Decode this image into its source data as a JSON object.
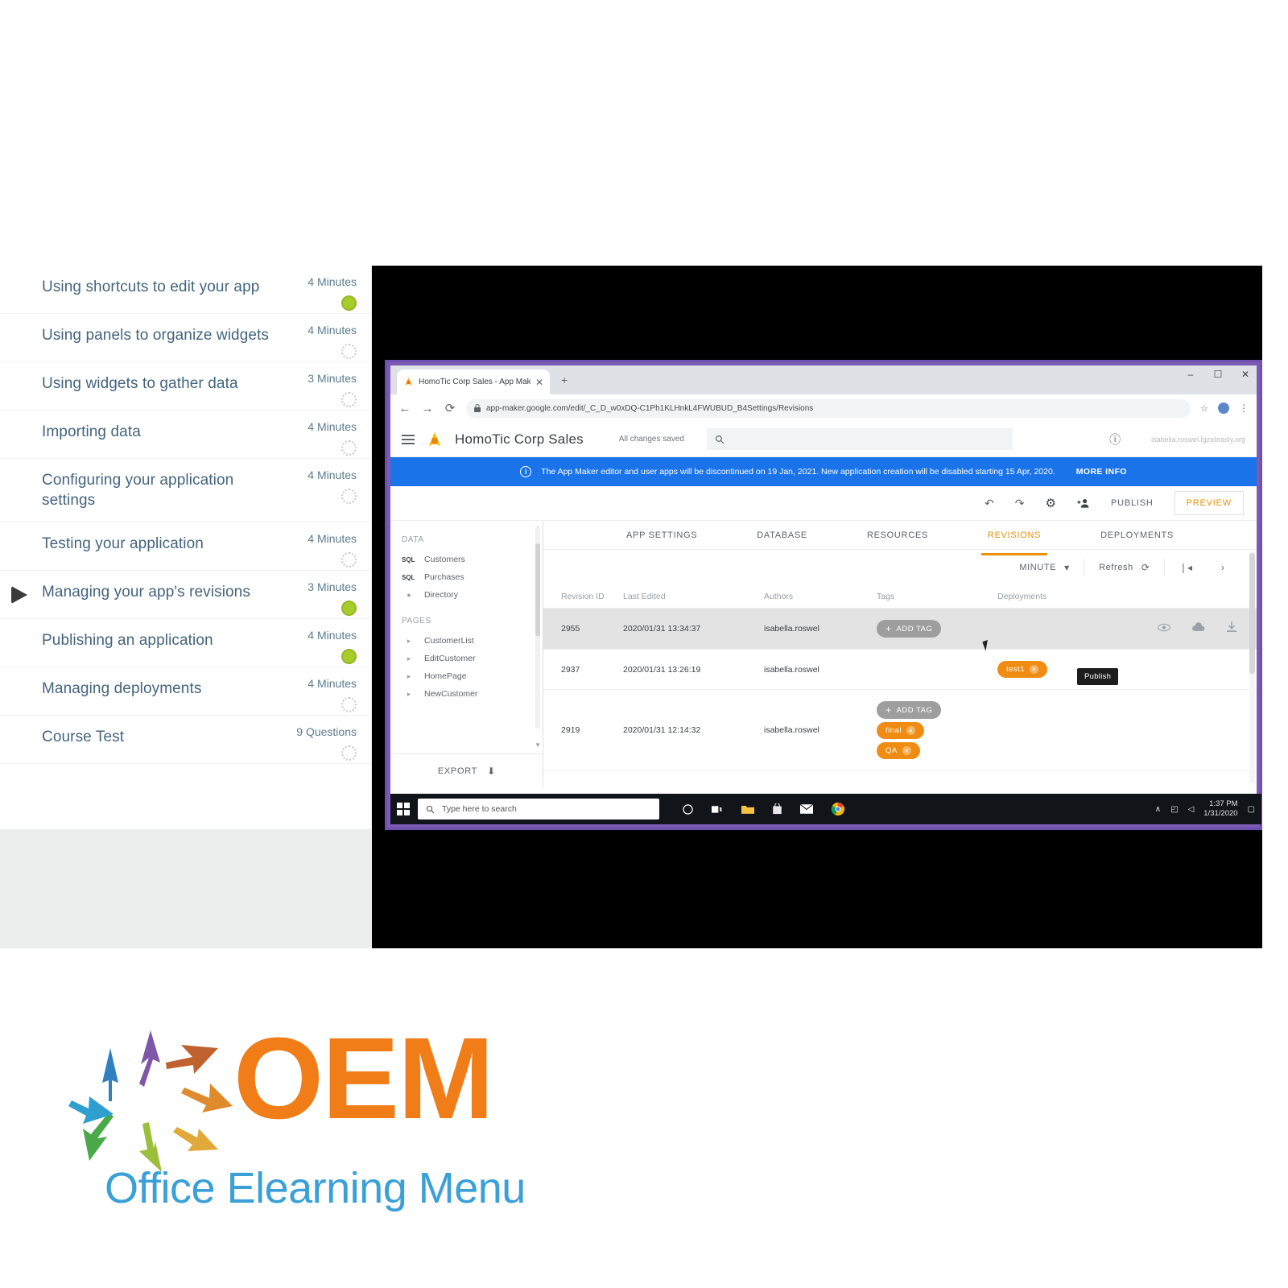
{
  "course": {
    "lessons": [
      {
        "title": "Using shortcuts to edit your app",
        "duration": "4 Minutes",
        "status": "done",
        "current": false
      },
      {
        "title": "Using panels to organize widgets",
        "duration": "4 Minutes",
        "status": "todo",
        "current": false
      },
      {
        "title": "Using widgets to gather data",
        "duration": "3 Minutes",
        "status": "todo",
        "current": false
      },
      {
        "title": "Importing data",
        "duration": "4 Minutes",
        "status": "todo",
        "current": false
      },
      {
        "title": "Configuring your application settings",
        "duration": "4 Minutes",
        "status": "todo",
        "current": false
      },
      {
        "title": "Testing your application",
        "duration": "4 Minutes",
        "status": "todo",
        "current": false
      },
      {
        "title": "Managing your app's revisions",
        "duration": "3 Minutes",
        "status": "done",
        "current": true
      },
      {
        "title": "Publishing an application",
        "duration": "4 Minutes",
        "status": "done",
        "current": false
      },
      {
        "title": "Managing deployments",
        "duration": "4 Minutes",
        "status": "todo",
        "current": false
      },
      {
        "title": "Course Test",
        "duration": "9 Questions",
        "status": "todo",
        "current": false
      }
    ]
  },
  "browser": {
    "tab_title": "HomoTic Corp Sales - App Mak",
    "tab_close": "✕",
    "new_tab": "+",
    "minimize": "–",
    "maximize": "☐",
    "close": "✕",
    "back": "←",
    "forward": "→",
    "reload": "⟳",
    "lock": "ὑ2",
    "url": "app-maker.google.com/edit/_C_D_w0xDQ-C1Ph1KLHnkL4FWUBUD_B4Settings/Revisions",
    "star": "☆",
    "kebab": "⋮"
  },
  "app": {
    "title": "HomoTic Corp Sales",
    "saved_status": "All changes saved",
    "search_placeholder": "",
    "user_email": "isabella.roswel.lgzebrasly.org",
    "banner_text": "The App Maker editor and user apps will be discontinued on 19 Jan, 2021. New application creation will be disabled starting 15 Apr, 2020.",
    "banner_more": "MORE INFO",
    "banner_color": "#1a73e8",
    "toolbar": {
      "undo": "↶",
      "redo": "↷",
      "settings": "⚙",
      "add_user": "⬚",
      "publish": "PUBLISH",
      "preview": "PREVIEW",
      "preview_color": "#e8920a"
    }
  },
  "left_panel": {
    "data_heading": "DATA",
    "data_items": [
      {
        "badge": "SQL",
        "label": "Customers"
      },
      {
        "badge": "SQL",
        "label": "Purchases"
      },
      {
        "badge": "",
        "label": "Directory"
      }
    ],
    "pages_heading": "PAGES",
    "pages_items": [
      {
        "label": "CustomerList"
      },
      {
        "label": "EditCustomer"
      },
      {
        "label": "HomePage"
      },
      {
        "label": "NewCustomer"
      }
    ],
    "export_label": "EXPORT",
    "export_icon": "⬇"
  },
  "editor_tabs": [
    {
      "label": "APP SETTINGS",
      "active": false
    },
    {
      "label": "DATABASE",
      "active": false
    },
    {
      "label": "RESOURCES",
      "active": false
    },
    {
      "label": "REVISIONS",
      "active": true
    },
    {
      "label": "DEPLOYMENTS",
      "active": false
    }
  ],
  "revisions": {
    "granularity": "MINUTE",
    "granularity_caret": "▾",
    "refresh_label": "Refresh",
    "refresh_icon": "⟳",
    "page_first": "❘◂",
    "page_next": "›",
    "columns": [
      "Revision ID",
      "Last Edited",
      "Authors",
      "Tags",
      "Deployments",
      ""
    ],
    "rows": [
      {
        "id": "2955",
        "last_edited": "2020/01/31 13:34:37",
        "author": "isabella.roswel",
        "tags": [
          {
            "label": "ADD TAG",
            "type": "add"
          }
        ],
        "deployments": [],
        "selected": true,
        "actions": [
          "eye-icon",
          "cloud-upload-icon",
          "download-icon",
          "restore-icon"
        ]
      },
      {
        "id": "2937",
        "last_edited": "2020/01/31 13:26:19",
        "author": "isabella.roswel",
        "tags": [],
        "deployments": [
          {
            "label": "test1",
            "type": "tag"
          }
        ],
        "selected": false,
        "actions": []
      },
      {
        "id": "2919",
        "last_edited": "2020/01/31 12:14:32",
        "author": "isabella.roswel",
        "tags": [
          {
            "label": "ADD TAG",
            "type": "add"
          },
          {
            "label": "final",
            "type": "tag"
          },
          {
            "label": "QA",
            "type": "tag"
          }
        ],
        "deployments": [],
        "selected": false,
        "actions": []
      }
    ],
    "tooltip": "Publish",
    "chip_add_color": "#9e9e9e",
    "chip_tag_color": "#f08c12"
  },
  "taskbar": {
    "search_placeholder": "Type here to search",
    "search_icon": "⚲",
    "apps": [
      "cortana-icon",
      "task-view-icon",
      "file-explorer-icon",
      "store-icon",
      "mail-icon",
      "chrome-icon"
    ],
    "tray_up": "∧",
    "tray_network": "◰",
    "tray_sound": "◁",
    "time": "1:37 PM",
    "date": "1/31/2020",
    "notification": "▢"
  },
  "brand": {
    "name": "OEM",
    "tagline": "Office Elearning Menu",
    "name_color": "#f07d18",
    "tagline_color": "#3aa0d8"
  }
}
